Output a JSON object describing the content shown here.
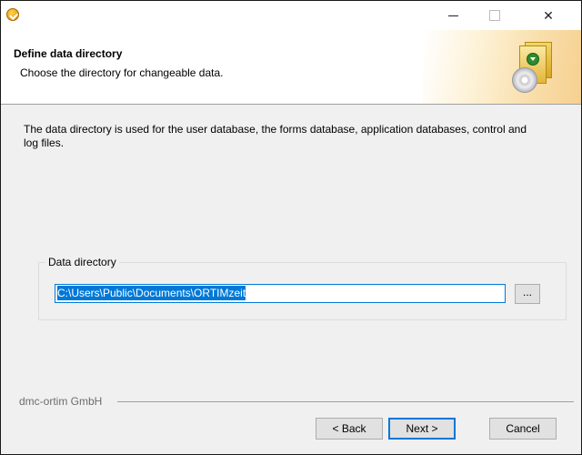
{
  "titlebar": {
    "minimize_glyph": "—",
    "close_glyph": "✕"
  },
  "header": {
    "title": "Define data directory",
    "subtitle": "Choose the directory for changeable data."
  },
  "main": {
    "description": "The data directory is used for the user database, the forms database, application databases, control and log files."
  },
  "data_directory": {
    "group_label": "Data directory",
    "value": "C:\\Users\\Public\\Documents\\ORTIMzeit",
    "browse_label": "..."
  },
  "footer": {
    "brand": "dmc-ortim GmbH",
    "back_label": "< Back",
    "next_label": "Next >",
    "cancel_label": "Cancel"
  },
  "colors": {
    "accent": "#0078d7",
    "header_bg": "#ffffff",
    "dialog_bg": "#f0f0f0"
  },
  "icons": [
    "setup-app-icon",
    "minimize-icon",
    "maximize-icon",
    "close-icon",
    "software-box-icon",
    "cd-disc-icon",
    "download-arrow-icon"
  ]
}
